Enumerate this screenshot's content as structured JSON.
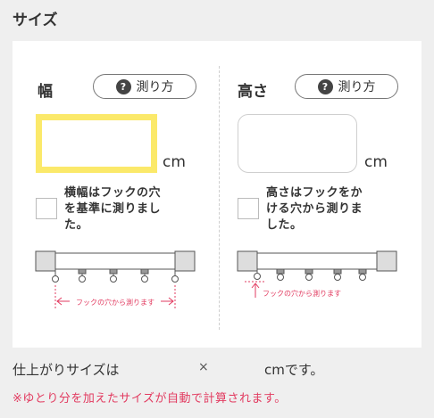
{
  "section_title": "サイズ",
  "width": {
    "title": "幅",
    "measure_button": "測り方",
    "value": "",
    "unit": "cm",
    "checkbox_label_lines": [
      "横幅はフックの穴",
      "を基準に測りまし",
      "た。"
    ],
    "checked": false,
    "diagram_caption": "フックの穴から測ります"
  },
  "height": {
    "title": "高さ",
    "measure_button": "測り方",
    "value": "",
    "unit": "cm",
    "checkbox_label_lines": [
      "高さはフックをか",
      "ける穴から測りま",
      "した。"
    ],
    "checked": false,
    "diagram_caption": "フックの穴から測ります"
  },
  "summary": {
    "label": "仕上がりサイズは",
    "separator": "×",
    "unit_text": "cmです。"
  },
  "note": "※ゆとり分を加えたサイズが自動で計算されます。",
  "colors": {
    "active_border": "#fbe96a",
    "accent_red": "#e23b60",
    "panel_bg": "#ffffff",
    "page_bg": "#efefef"
  }
}
